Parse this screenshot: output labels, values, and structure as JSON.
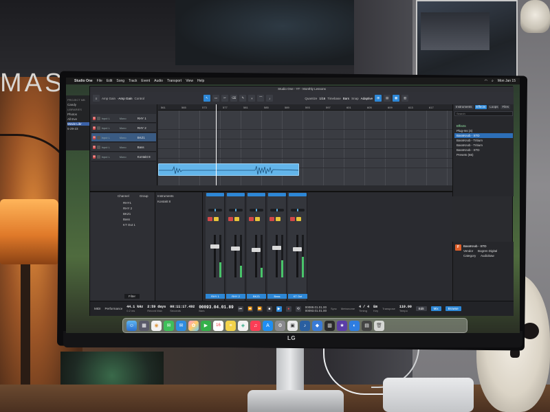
{
  "room": {
    "banner_text": "MAS",
    "monitor_brand": "LG"
  },
  "menubar": {
    "app_name": "Studio One",
    "items": [
      "File",
      "Edit",
      "Song",
      "Track",
      "Event",
      "Audio",
      "Transport",
      "View",
      "Help"
    ],
    "datetime": "Mon Jan 15"
  },
  "finder": {
    "header_project": "PROJECT MB",
    "item_1": "Candy",
    "header_libraries": "LIBRARIES",
    "item_2": "Photos",
    "item_3": "All Eve",
    "item_selected": "Movie Libr",
    "item_date": "5-29-23"
  },
  "studio_one": {
    "window_title": "Studio One - YT - Monthly Lessons",
    "toolbar": {
      "track_label": "Amp Gain",
      "track_value": "-Amp Gain",
      "control_label": "Control",
      "quantize_label": "Quantize",
      "quantize_value": "1/16",
      "timebase_label": "Timebase",
      "timebase_value": "Bars",
      "snap_label": "Snap",
      "snap_value": "Adaptive"
    },
    "tracks": [
      {
        "name": "RHY 1",
        "input": "Input L",
        "mode": "Mono"
      },
      {
        "name": "RHY 2",
        "input": "Input L",
        "mode": "Mono"
      },
      {
        "name": "BKZ1",
        "input": "Input L",
        "mode": "Mono"
      },
      {
        "name": "Bass",
        "input": "Input L",
        "mode": "Mono"
      },
      {
        "name": "Kontakt 8",
        "input": "Input L",
        "mode": "Mono"
      }
    ],
    "ruler_ticks": [
      "561",
      "565",
      "573",
      "577",
      "581",
      "585",
      "589",
      "593",
      "597",
      "601",
      "605",
      "609",
      "613",
      "617"
    ],
    "browser": {
      "tabs": [
        "Instruments",
        "Effects",
        "Loops",
        "Files"
      ],
      "active_tab": "Effects",
      "search_placeholder": "Search",
      "items": [
        "Effects",
        "Plug-Ins (4)",
        "BassKnob - STD",
        "BassKnob - Tritium",
        "BassKnob - Tritium",
        "BassKnob - STD",
        "Presets (66)"
      ],
      "selected_index": 2
    },
    "console": {
      "columns": [
        "Channel",
        "Group",
        "Instruments"
      ],
      "channels": [
        "RHY1",
        "RHY 2",
        "BKZ1",
        "Bass",
        "KT Out 1"
      ],
      "instrument": "Kontakt 8",
      "filter_label": "Filter",
      "strips": [
        {
          "name": "RHY 1",
          "fader": 0.72,
          "meter": 0.35,
          "pan": 0.5
        },
        {
          "name": "RHY 2",
          "fader": 0.68,
          "meter": 0.28,
          "pan": 0.5
        },
        {
          "name": "BKZ1",
          "fader": 0.64,
          "meter": 0.22,
          "pan": 0.5
        },
        {
          "name": "Bass",
          "fader": 0.7,
          "meter": 0.4,
          "pan": 0.5
        },
        {
          "name": "KT Out",
          "fader": 0.66,
          "meter": 0.48,
          "pan": 0.5
        }
      ],
      "auto_off": "Auto Off"
    },
    "inspector": {
      "badge": "F",
      "plugin_name": "BassKnob - STD",
      "vendor_label": "Vendor",
      "vendor_value": "Bogren Digital",
      "category_label": "Category",
      "category_value": "Audiobaw"
    },
    "transport": {
      "midi_label": "MIDI",
      "performance_label": "Performance",
      "sample_rate": "44.1 kHz",
      "latency": "0.2 ms",
      "record_days": "2:59 days",
      "record_max": "Record Max",
      "seconds_value": "00:11:17.492",
      "seconds_label": "Seconds",
      "bars_value": "00093.04.01.89",
      "bars_label": "Bars",
      "loop_start": "00089.01.01.00",
      "loop_end": "00093.01.01.00",
      "sync_label": "Sync",
      "metronome_label": "Metronome",
      "timesig_value": "4 / 4",
      "timing_label": "Timing",
      "key_value": "Em",
      "key_label": "Key",
      "transpose_label": "Transpose",
      "tempo_value": "110.00",
      "tempo_label": "Tempo",
      "edit_label": "Edit",
      "mix_label": "Mix",
      "browse_label": "Browse"
    }
  },
  "colors": {
    "accent_blue": "#2d87d6",
    "clip_blue": "#63b5ea",
    "mute_red": "#d24848",
    "solo_yellow": "#e8c43a"
  }
}
